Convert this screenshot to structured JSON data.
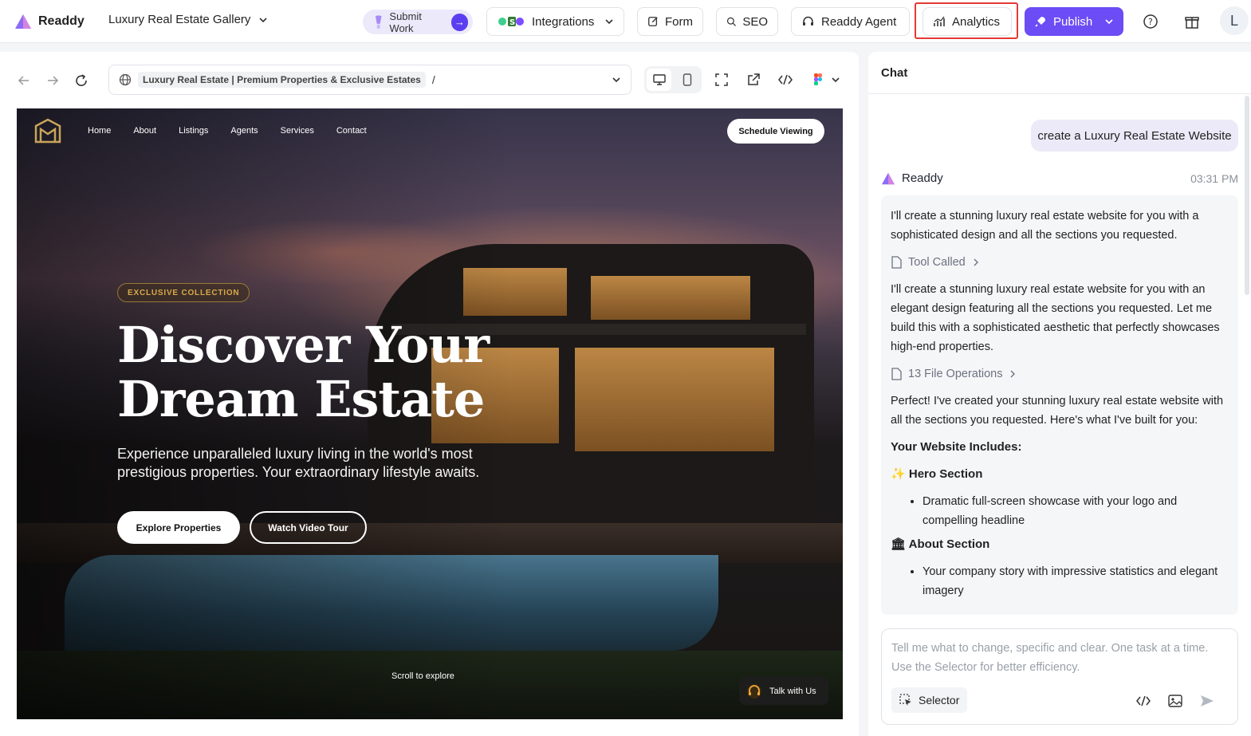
{
  "app": {
    "name": "Readdy",
    "project": "Luxury Real Estate Gallery",
    "accent": "#6c4cf5",
    "highlight": "#e53935"
  },
  "toolbar": {
    "submit_label": "Submit Work",
    "integrations_label": "Integrations",
    "form_label": "Form",
    "seo_label": "SEO",
    "agent_label": "Readdy Agent",
    "analytics_label": "Analytics",
    "publish_label": "Publish",
    "avatar_initial": "L"
  },
  "preview": {
    "url_title": "Luxury Real Estate | Premium Properties & Exclusive Estates",
    "url_path": "/"
  },
  "site": {
    "nav": [
      "Home",
      "About",
      "Listings",
      "Agents",
      "Services",
      "Contact"
    ],
    "schedule_label": "Schedule Viewing",
    "badge": "EXCLUSIVE COLLECTION",
    "headline_1": "Discover Your",
    "headline_2": "Dream Estate",
    "subline": "Experience unparalleled luxury living in the world's most prestigious properties. Your extraordinary lifestyle awaits.",
    "explore_label": "Explore Properties",
    "tour_label": "Watch Video Tour",
    "scroll_hint": "Scroll to explore",
    "talk_label": "Talk with Us"
  },
  "chat": {
    "title": "Chat",
    "user_message": "create a Luxury Real Estate Website",
    "bot_name": "Readdy",
    "bot_time": "03:31 PM",
    "p1": "I'll create a stunning luxury real estate website for you with a sophisticated design and all the sections you requested.",
    "tool_called": "Tool Called",
    "p2": "I'll create a stunning luxury real estate website for you with an elegant design featuring all the sections you requested. Let me build this with a sophisticated aesthetic that perfectly showcases high-end properties.",
    "file_ops": "13 File Operations",
    "p3": "Perfect! I've created your stunning luxury real estate website with all the sections you requested. Here's what I've built for you:",
    "includes_heading": "Your Website Includes:",
    "hero_icon": "✨",
    "hero_heading": "Hero Section",
    "hero_item": "Dramatic full-screen showcase with your logo and compelling headline",
    "about_icon": "🏛",
    "about_heading": "About Section",
    "about_item": "Your company story with impressive statistics and elegant imagery",
    "composer_placeholder": "Tell me what to change, specific and clear. One task at a time. Use the Selector for better efficiency.",
    "selector_label": "Selector"
  }
}
